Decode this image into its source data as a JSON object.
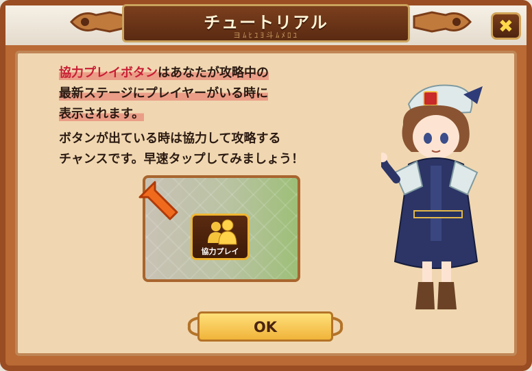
{
  "dialog": {
    "title": "チュートリアル",
    "subtitle_glyphs": "ヨﾑﾋﾕﾖ斗ﾑﾒﾛﾕ",
    "close_label": "✖"
  },
  "message": {
    "line1_highlight": "協力プレイボタン",
    "line1_rest": "はあなたが攻略中の",
    "line2": "最新ステージにプレイヤーがいる時に",
    "line3": "表示されます。",
    "line4": "ボタンが出ている時は協力して攻略する",
    "line5": "チャンスです。早速タップしてみましょう！"
  },
  "coop_button": {
    "label": "協力プレイ"
  },
  "ok_button": {
    "label": "OK"
  },
  "colors": {
    "frame": "#9a4c22",
    "panel": "#f0d7b1",
    "highlight_text": "#c81e34",
    "button_gold": "#f0b43a"
  }
}
